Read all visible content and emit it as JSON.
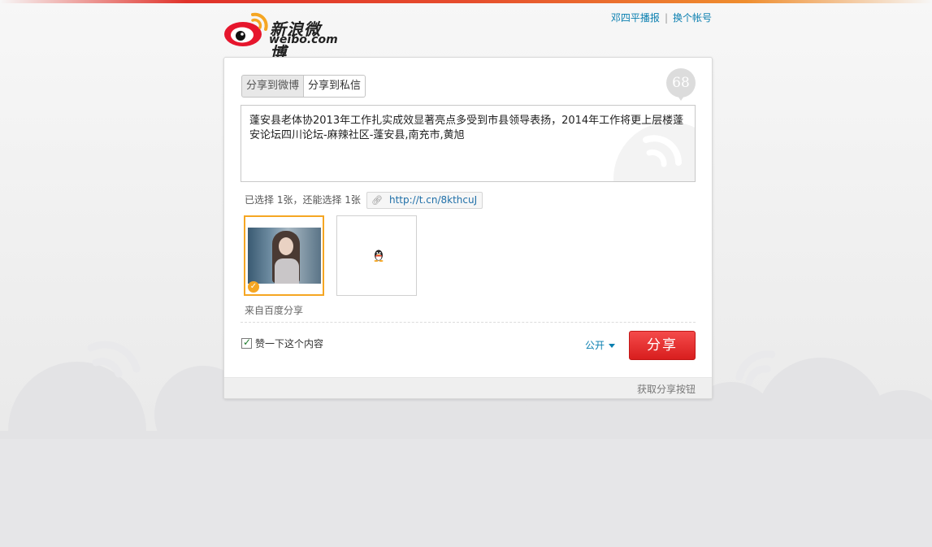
{
  "brand": {
    "name_cn": "新浪微博",
    "domain": "weibo.com",
    "accent": "#e6162d",
    "link_color": "#0a7fb0"
  },
  "account": {
    "username": "邓四平播报",
    "separator": "|",
    "switch_label": "换个帐号"
  },
  "tabs": [
    {
      "label": "分享到微博",
      "active": true
    },
    {
      "label": "分享到私信",
      "active": false
    }
  ],
  "composer": {
    "remaining_count": "68",
    "text": "蓬安县老体协2013年工作扎实成效显著亮点多受到市县领导表扬，2014年工作将更上层楼蓬安论坛四川论坛-麻辣社区-蓬安县,南充市,黄旭"
  },
  "images": {
    "selection_tip": "已选择 1张，还能选择 1张",
    "short_url": "http://t.cn/8kthcuJ",
    "source_label": "来自百度分享",
    "items": [
      {
        "icon": "photo-thumbnail",
        "selected": true
      },
      {
        "icon": "qq-penguin-icon",
        "selected": false
      }
    ]
  },
  "actions": {
    "like_label": "赞一下这个内容",
    "like_checked": true,
    "visibility_label": "公开",
    "share_label": "分享"
  },
  "footer": {
    "get_button_label": "获取分享按钮"
  }
}
